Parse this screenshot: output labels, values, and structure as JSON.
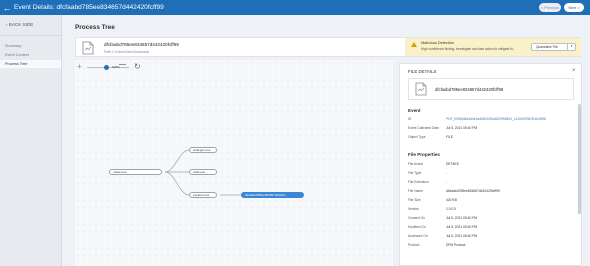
{
  "topbar": {
    "title": "Event Details: dfcfaabd785ee834657d442420fcff99",
    "prev_label": "< Previous",
    "next_label": "Next >"
  },
  "sidebar": {
    "back_label": "‹ BACK SIDE",
    "items": [
      {
        "label": "Summary",
        "active": false
      },
      {
        "label": "Event Context",
        "active": false
      },
      {
        "label": "Process Tree",
        "active": true
      }
    ]
  },
  "main": {
    "title": "Process Tree",
    "file": {
      "name": "dfcfaabd785ee834657d442420fcff99",
      "path": "Path: C:\\Users\\User\\Downloads"
    },
    "alert": {
      "title": "Malicious Detection",
      "text": "High confidence finding, investigate and take action to mitigate th...",
      "button_label": "Quarantine File"
    }
  },
  "tree": {
    "zoom_label": "100%",
    "nodes": [
      {
        "label": "mstsc.exe"
      },
      {
        "label": "winlogon.exe"
      },
      {
        "label": "sshd.exe"
      },
      {
        "label": "explorer.exe"
      },
      {
        "label": "dfcfaabd785ee834657d44242..."
      }
    ]
  },
  "details": {
    "title": "FILE DETAILS",
    "file_name": "dfcfaabd785ee834657d442420fcff99",
    "event_section": "Event",
    "event_rows": [
      {
        "key": "ID",
        "value": "PDF_f09fb46fa4d4e4a4b8210f6c62f29f48f32_1126067f6f2f14b2f6f6",
        "link": true
      },
      {
        "key": "Event Collected Date",
        "value": "Jul 5, 2021 05:40 PM",
        "link": false
      },
      {
        "key": "Object Type",
        "value": "FILE",
        "link": false
      }
    ],
    "props_section": "File Properties",
    "props_rows": [
      {
        "key": "File Action",
        "value": "DETAKE"
      },
      {
        "key": "File Type",
        "value": "-"
      },
      {
        "key": "File Extension",
        "value": "-"
      },
      {
        "key": "File Name",
        "value": "dfcfaabd785ee834657d442420fcff99"
      },
      {
        "key": "File Size",
        "value": "420 KB"
      },
      {
        "key": "Version",
        "value": "1.0.0.0"
      },
      {
        "key": "Created On",
        "value": "Jul 5, 2021 05:40 PM"
      },
      {
        "key": "Modified On",
        "value": "Jul 5, 2021 05:40 PM"
      },
      {
        "key": "Accessed On",
        "value": "Jul 5, 2021 05:40 PM"
      },
      {
        "key": "Product",
        "value": "DFM Product"
      }
    ]
  }
}
